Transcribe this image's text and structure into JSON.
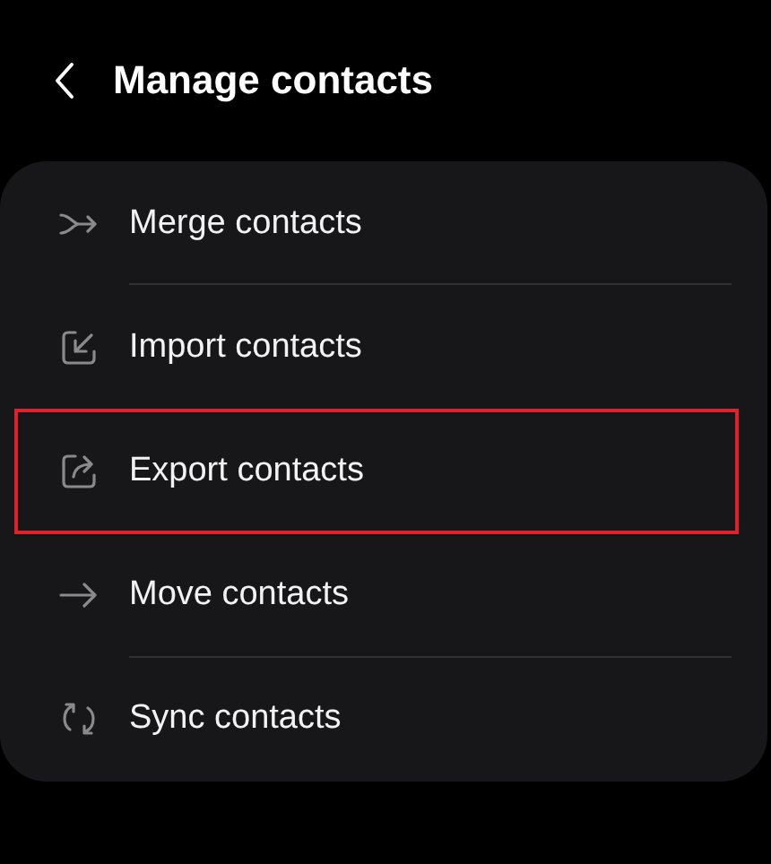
{
  "header": {
    "title": "Manage contacts"
  },
  "items": [
    {
      "kind": "merge",
      "label": "Merge contacts",
      "divider": true,
      "highlighted": false
    },
    {
      "kind": "import",
      "label": "Import contacts",
      "divider": false,
      "highlighted": false
    },
    {
      "kind": "export",
      "label": "Export contacts",
      "divider": false,
      "highlighted": true
    },
    {
      "kind": "move",
      "label": "Move contacts",
      "divider": true,
      "highlighted": false
    },
    {
      "kind": "sync",
      "label": "Sync contacts",
      "divider": false,
      "highlighted": false
    }
  ]
}
